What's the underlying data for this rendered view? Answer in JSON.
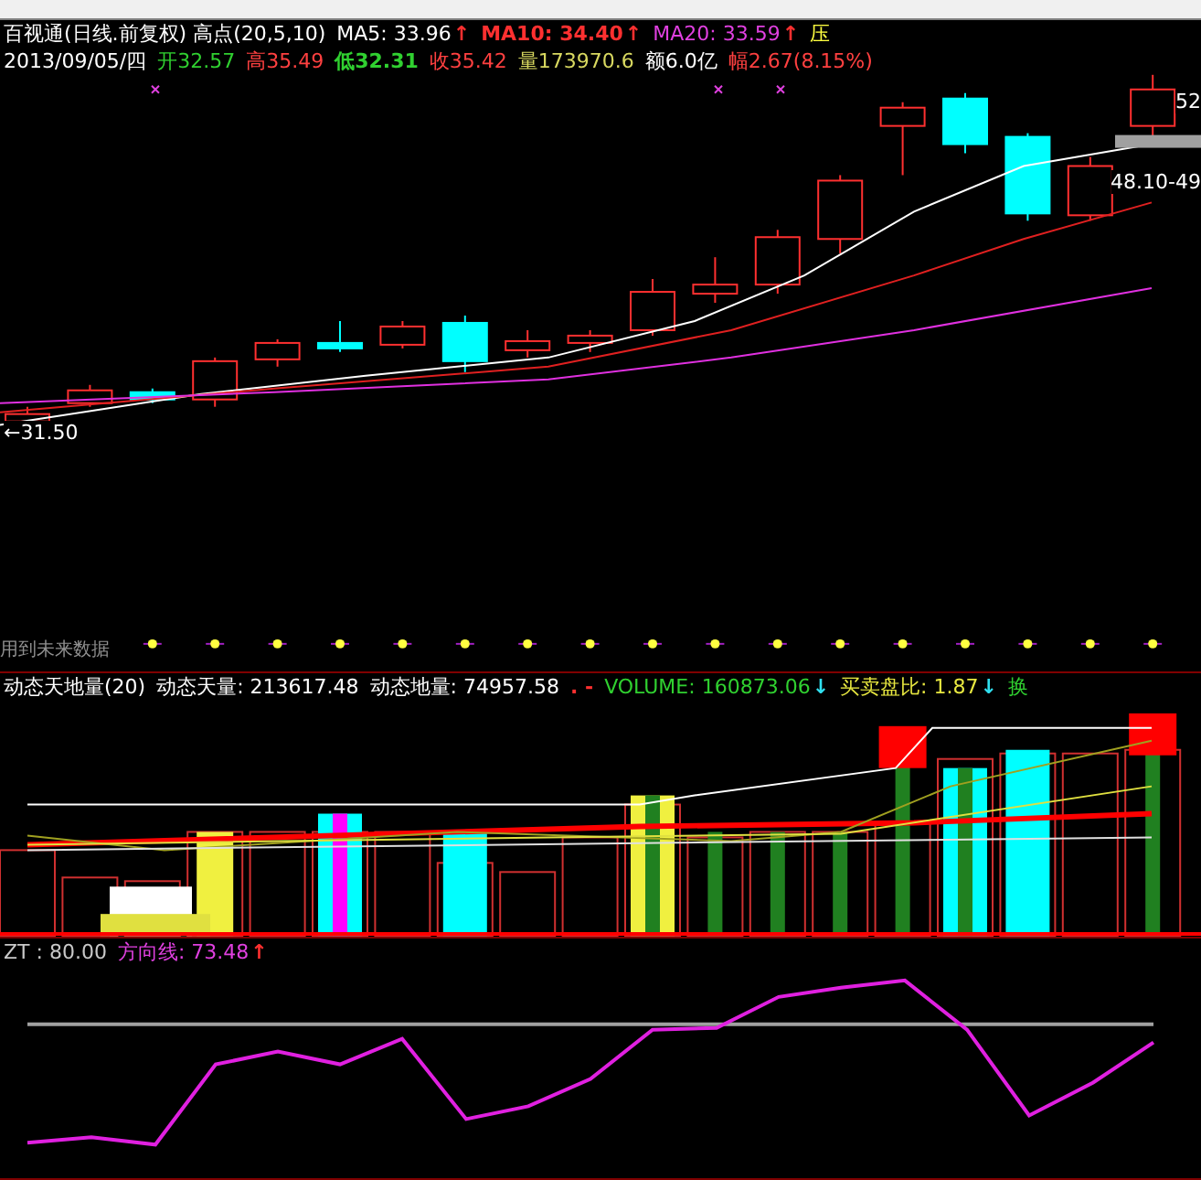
{
  "main_panel": {
    "header_lines": [
      [
        {
          "kind": "text",
          "text": "百视通(日线.前复权) 高点(20,5,10)",
          "color": "#ffffff"
        },
        {
          "kind": "text",
          "text": "MA5: 33.96",
          "color": "#ffffff"
        },
        {
          "kind": "arrow",
          "text": "↑",
          "color": "#ff3030"
        },
        {
          "kind": "text",
          "text": "MA10: 34.40",
          "color": "#ff3030"
        },
        {
          "kind": "arrow",
          "text": "↑",
          "color": "#ff3030"
        },
        {
          "kind": "text",
          "text": "MA20: 33.59",
          "color": "#e040e0"
        },
        {
          "kind": "arrow",
          "text": "↑",
          "color": "#ff3030"
        },
        {
          "kind": "text",
          "text": "压",
          "color": "#ffff40"
        }
      ],
      [
        {
          "kind": "text",
          "text": "2013/09/05/四",
          "color": "#ffffff"
        },
        {
          "kind": "text",
          "text": "开32.57",
          "color": "#30d030"
        },
        {
          "kind": "text",
          "text": "高35.49",
          "color": "#ff4040"
        },
        {
          "kind": "text",
          "text": "低32.31",
          "color": "#30d030"
        },
        {
          "kind": "text",
          "text": "收35.42",
          "color": "#ff4040"
        },
        {
          "kind": "text",
          "text": "量173970.6",
          "color": "#d8d860"
        },
        {
          "kind": "text",
          "text": "额6.0亿",
          "color": "#ffffff"
        },
        {
          "kind": "text",
          "text": "幅2.67(8.15%)",
          "color": "#ff4040"
        }
      ]
    ],
    "price_labels": [
      {
        "text": "←31.50",
        "kind": "low"
      },
      {
        "text": "48.10-49",
        "kind": "range"
      },
      {
        "text": "52",
        "kind": "high"
      }
    ],
    "future_data_label": "用到未来数据"
  },
  "volume_panel": {
    "header": [
      {
        "kind": "text",
        "text": "动态天地量(20)",
        "color": "#ffffff"
      },
      {
        "kind": "text",
        "text": "动态天量: 213617.48",
        "color": "#ffffff"
      },
      {
        "kind": "text",
        "text": "动态地量: 74957.58",
        "color": "#ffffff"
      },
      {
        "kind": "text",
        "text": ". -",
        "color": "#ff3030"
      },
      {
        "kind": "text",
        "text": "VOLUME: 160873.06",
        "color": "#30d030"
      },
      {
        "kind": "arrow",
        "text": "↓",
        "color": "#30e0f0"
      },
      {
        "kind": "text",
        "text": "买卖盘比: 1.87",
        "color": "#e8e840"
      },
      {
        "kind": "arrow",
        "text": "↓",
        "color": "#30e0f0"
      },
      {
        "kind": "text",
        "text": "换",
        "color": "#30d030"
      }
    ]
  },
  "direction_panel": {
    "header": [
      {
        "kind": "text",
        "text": "ZT : 80.00",
        "color": "#c8c8c8"
      },
      {
        "kind": "text",
        "text": "方向线: 73.48",
        "color": "#e040e0"
      },
      {
        "kind": "arrow",
        "text": "↑",
        "color": "#ff3030"
      }
    ]
  }
}
